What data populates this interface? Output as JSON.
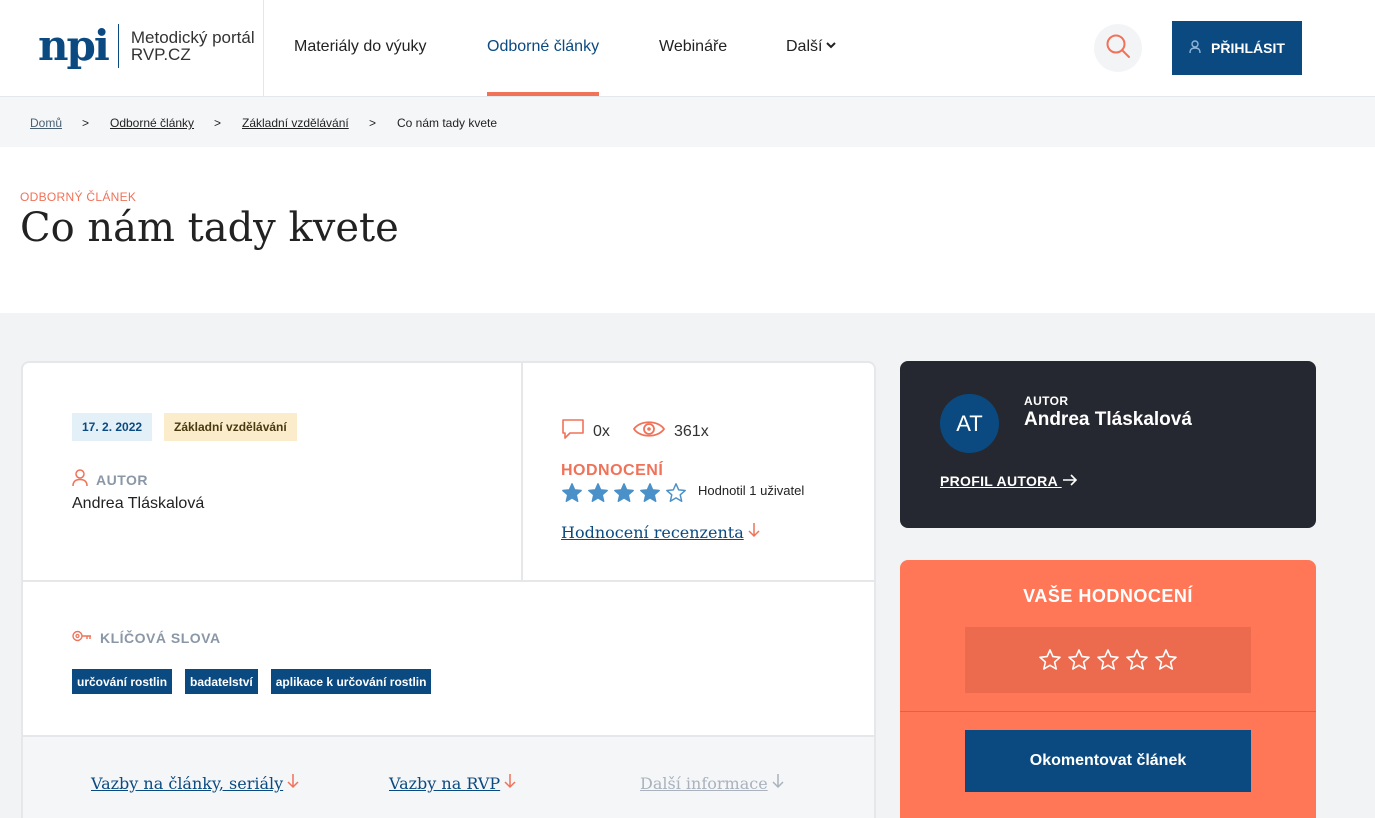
{
  "header": {
    "logo_mark": "npi",
    "logo_line1": "Metodický portál",
    "logo_line2": "RVP.CZ",
    "nav": [
      {
        "label": "Materiály do výuky"
      },
      {
        "label": "Odborné články",
        "active": true
      },
      {
        "label": "Webináře"
      },
      {
        "label": "Další"
      }
    ],
    "login_label": "PŘIHLÁSIT"
  },
  "breadcrumb": [
    "Domů",
    "Odborné články",
    "Základní vzdělávání",
    "Co nám tady kvete"
  ],
  "breadcrumb_separator": ">",
  "article": {
    "kicker": "ODBORNÝ ČLÁNEK",
    "title": "Co nám tady kvete",
    "date": "17. 2. 2022",
    "level": "Základní vzdělávání",
    "author_label": "AUTOR",
    "author_name": "Andrea Tláskalová",
    "comments": "0x",
    "views": "361x",
    "rating_label": "HODNOCENÍ",
    "rating_value": 4,
    "rating_max": 5,
    "rated_by": "Hodnotil 1 uživatel",
    "reviewer_link": "Hodnocení recenzenta",
    "keywords_label": "KLÍČOVÁ SLOVA",
    "keywords": [
      "určování rostlin",
      "badatelství",
      "aplikace k určování rostlin"
    ],
    "bottom_links": [
      "Vazby na články, seriály",
      "Vazby na RVP",
      "Další informace"
    ]
  },
  "author_card": {
    "initials": "AT",
    "label": "AUTOR",
    "name": "Andrea Tláskalová",
    "profile_link": "PROFIL AUTORA"
  },
  "rating_card": {
    "title": "VAŠE HODNOCENÍ",
    "stars": 5,
    "comment_button": "Okomentovat článek"
  },
  "colors": {
    "brand_blue": "#0b4a80",
    "accent_coral": "#f07259",
    "rating_card_bg": "#ff7757",
    "author_card_bg": "#252830",
    "star_blue": "#4a90c9"
  }
}
